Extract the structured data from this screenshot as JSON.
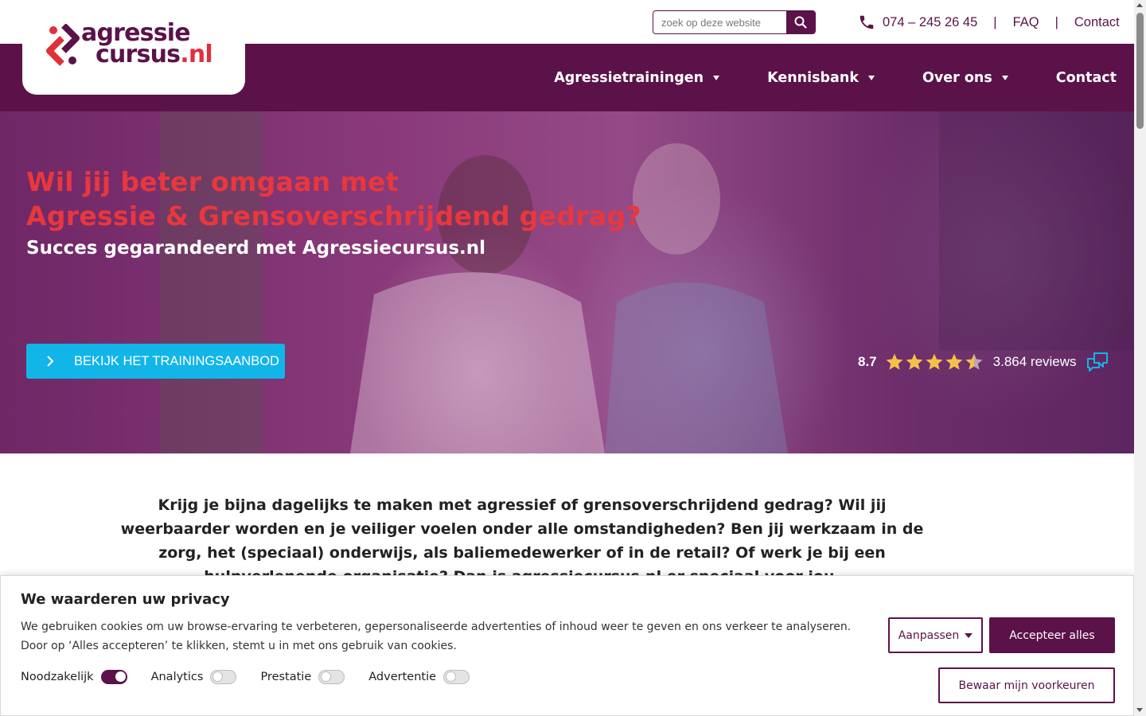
{
  "colors": {
    "brand_purple": "#5b1248",
    "accent_red": "#e8373d",
    "cta_blue": "#12b5e8",
    "star_gold": "#f5c04a"
  },
  "topbar": {
    "search_placeholder": "zoek op deze website",
    "search_icon": "search-icon",
    "phone_icon": "phone-icon",
    "phone": "074 – 245 26 45",
    "separator": "|",
    "faq": "FAQ",
    "contact": "Contact"
  },
  "logo": {
    "line1": "agressie",
    "line2": "cursus",
    "tld": ".nl"
  },
  "nav": {
    "items": [
      {
        "label": "Agressietrainingen",
        "has_dropdown": true
      },
      {
        "label": "Kennisbank",
        "has_dropdown": true
      },
      {
        "label": "Over ons",
        "has_dropdown": true
      },
      {
        "label": "Contact",
        "has_dropdown": false
      }
    ]
  },
  "hero": {
    "title_line1": "Wil jij beter omgaan met",
    "title_line2": "Agressie & Grensoverschrijdend gedrag?",
    "subtitle": "Succes gegarandeerd met Agressiecursus.nl",
    "cta_label": "BEKIJK HET TRAININGSAANBOD",
    "rating": {
      "score": "8.7",
      "stars_value": 4.5,
      "stars_max": 5,
      "reviews": "3.864 reviews",
      "icon": "reviews-chat-icon"
    }
  },
  "intro": {
    "text": "Krijg je bijna dagelijks te maken met agressief of grensoverschrijdend gedrag? Wil jij weerbaarder worden en je veiliger voelen onder alle omstandigheden? Ben jij werkzaam in de zorg, het (speciaal) onderwijs, als baliemedewerker of in de retail? Of werk je bij een hulpverlenende organisatie? Dan is agressiecursus.nl er speciaal voor jou."
  },
  "cookie": {
    "title": "We waarderen uw privacy",
    "text": "We gebruiken cookies om uw browse-ervaring te verbeteren, gepersonaliseerde advertenties of inhoud weer te geven en ons verkeer te analyseren. Door op ‘Alles accepteren’ te klikken, stemt u in met ons gebruik van cookies.",
    "toggles": [
      {
        "label": "Noodzakelijk",
        "on": true
      },
      {
        "label": "Analytics",
        "on": false
      },
      {
        "label": "Prestatie",
        "on": false
      },
      {
        "label": "Advertentie",
        "on": false
      }
    ],
    "customize_label": "Aanpassen",
    "accept_label": "Accepteer alles",
    "save_label": "Bewaar mijn voorkeuren"
  }
}
